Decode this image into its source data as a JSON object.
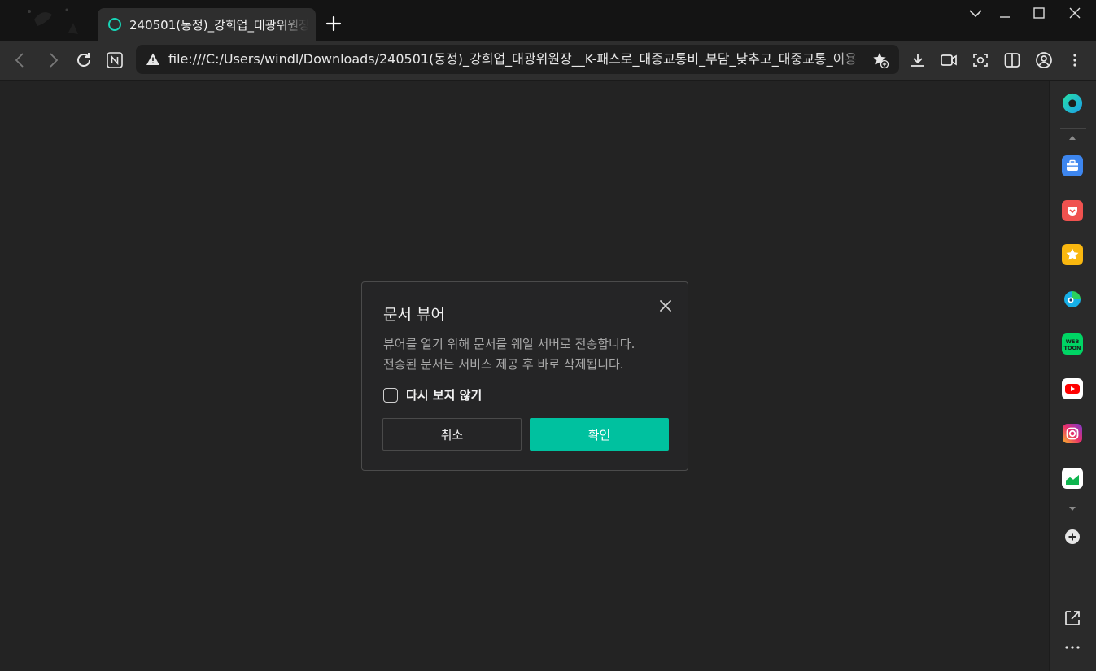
{
  "tab": {
    "title": "240501(동정)_강희업_대광위원장"
  },
  "url": "file:///C:/Users/windl/Downloads/240501(동정)_강희업_대광위원장__K-패스로_대중교통비_부담_낮추고_대중교통_이용",
  "dialog": {
    "title": "문서 뷰어",
    "message_line1": "뷰어를 열기 위해 문서를 웨일 서버로 전송합니다.",
    "message_line2": "전송된 문서는 서비스 제공 후 바로 삭제됩니다.",
    "checkbox_label": "다시 보지 않기",
    "checkbox_checked": false,
    "cancel_label": "취소",
    "ok_label": "확인"
  },
  "colors": {
    "accent": "#00c19f",
    "background": "#232323",
    "toolbar": "#2e2e2e"
  }
}
